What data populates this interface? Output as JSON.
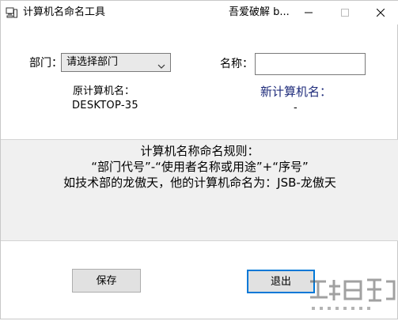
{
  "window": {
    "title": "计算机名命名工具",
    "title_extra": "吾爱破解 b..."
  },
  "form": {
    "department_label": "部门：",
    "department_selected": "请选择部门",
    "name_label": "名称：",
    "name_value": ""
  },
  "original": {
    "heading": "原计算机名：",
    "value": "DESKTOP-35"
  },
  "new_name": {
    "heading": "新计算机名：",
    "value": "-"
  },
  "rules": {
    "line1": "计算机名称命名规则：",
    "line2": "“部门代号”-“使用者名称或用途”+“序号”",
    "line3": "如技术部的龙傲天，他的计算机命名为：JSB-龙傲天"
  },
  "buttons": {
    "save": "保存",
    "exit": "退出"
  },
  "colors": {
    "new_heading": "#1d2a7a",
    "panel_bg": "#f0f0f0",
    "button_bg": "#e1e1e1",
    "focus_border": "#0078d7"
  },
  "icons": {
    "app": "computer-icon",
    "minimize": "minimize-icon",
    "maximize": "maximize-icon",
    "close": "close-icon",
    "dropdown": "chevron-down-icon"
  }
}
